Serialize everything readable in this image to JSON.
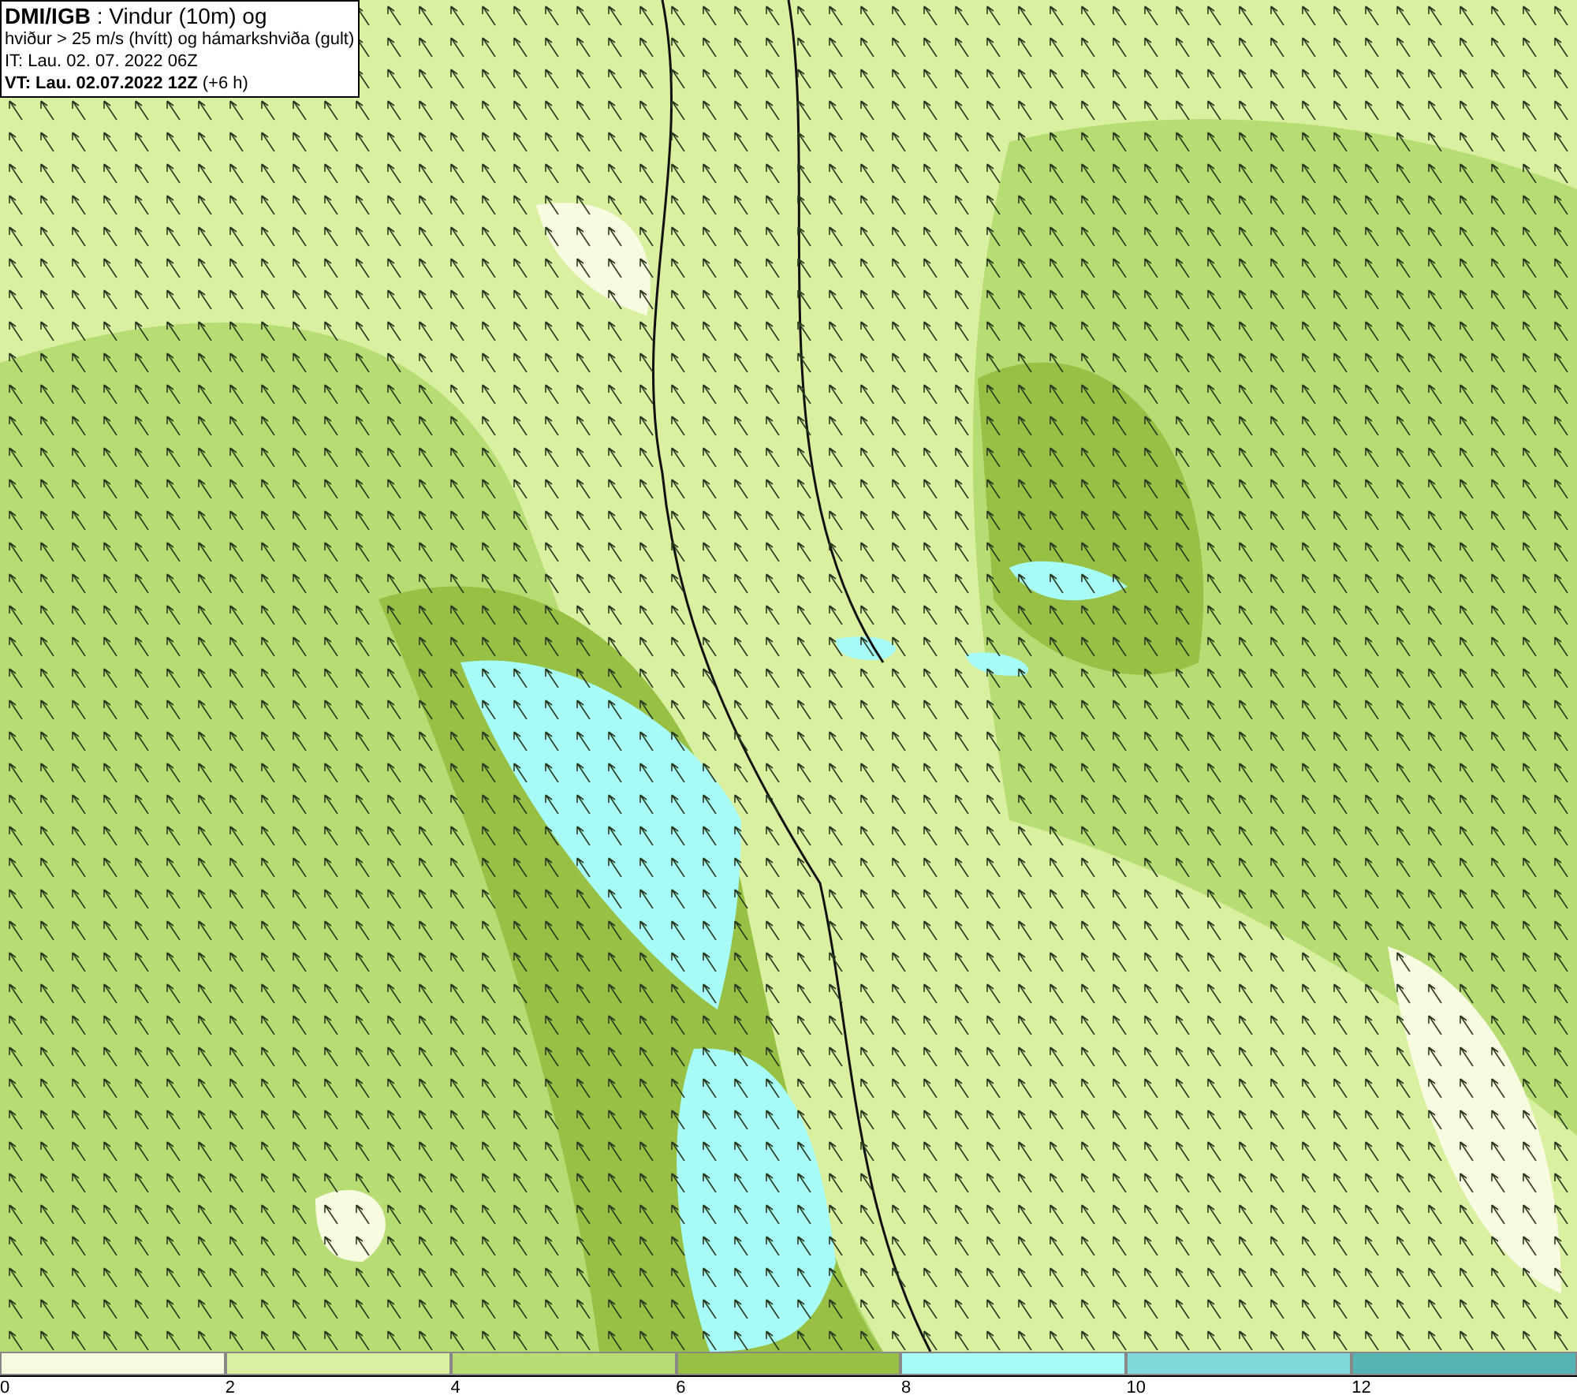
{
  "title_box": {
    "lines": [
      "**DMI/IGB** : Vindur (10m) og",
      "hviður > 25 m/s (hvítt) og hámarkshviða (gult)",
      "IT: Lau. 02. 07. 2022 06Z",
      "**VT: Lau. 02.07.2022 12Z** (+6 h)"
    ]
  },
  "legend": [
    {
      "label": "0",
      "color": "#f7fbe0"
    },
    {
      "label": "2",
      "color": "#d9f0a0"
    },
    {
      "label": "4",
      "color": "#b8dc74"
    },
    {
      "label": "6",
      "color": "#97c044"
    },
    {
      "label": "8",
      "color": "#a8fcf8"
    },
    {
      "label": "10",
      "color": "#80d8d8"
    },
    {
      "label": "12",
      "color": "#56b4b4"
    }
  ]
}
